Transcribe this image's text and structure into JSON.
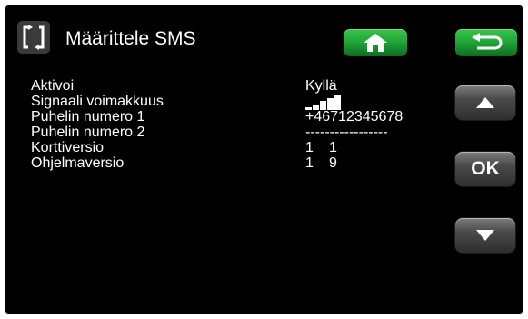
{
  "header": {
    "title": "Määrittele SMS",
    "title_icon": "menu-bracket-arrows-icon",
    "home_icon": "home-icon",
    "back_icon": "back-arrow-icon"
  },
  "params": {
    "rows": [
      {
        "label": "Aktivoi",
        "value": "Kyllä"
      },
      {
        "label": "Signaali voimakkuus",
        "value_type": "signal-bars",
        "signal_level": 5,
        "signal_max": 5
      },
      {
        "label": "Puhelin numero 1",
        "value": "+46712345678"
      },
      {
        "label": "Puhelin numero 2",
        "value": "-----------------"
      },
      {
        "label": "Korttiversio",
        "value": "1",
        "value2": "1"
      },
      {
        "label": "Ohjelmaversio",
        "value": "1",
        "value2": "9"
      }
    ]
  },
  "nav": {
    "up_icon": "arrow-up-icon",
    "ok_label": "OK",
    "down_icon": "arrow-down-icon"
  },
  "colors": {
    "background": "#000000",
    "text": "#ffffff",
    "accent_green": "#22a83a",
    "button_gray": "#4a4a4a"
  }
}
